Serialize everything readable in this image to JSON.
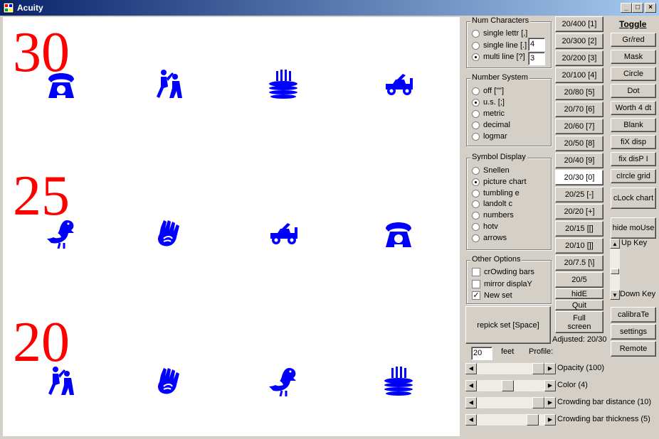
{
  "window": {
    "title": "Acuity",
    "minimize": "_",
    "maximize": "□",
    "close": "×"
  },
  "chart": {
    "rows": [
      {
        "label": "30",
        "symbols": [
          "telephone",
          "dancers",
          "cake",
          "jeep"
        ]
      },
      {
        "label": "25",
        "symbols": [
          "bird",
          "hand",
          "jeep",
          "telephone"
        ]
      },
      {
        "label": "20",
        "symbols": [
          "dancers",
          "hand",
          "bird",
          "cake"
        ]
      }
    ],
    "symbol_color": "#0000ff",
    "label_color": "#ff0000"
  },
  "num_characters": {
    "title": "Num Characters",
    "options": [
      "single lettr [,]",
      "single line [.]",
      "multi line [?]"
    ],
    "selected": 2,
    "single_line_value": "4",
    "multi_line_value": "3"
  },
  "number_system": {
    "title": "Number System",
    "options": [
      "off [\"\"]",
      "u.s. [;]",
      "metric",
      "decimal",
      "logmar"
    ],
    "selected": 1
  },
  "symbol_display": {
    "title": "Symbol Display",
    "options": [
      "Snellen",
      "picture chart",
      "tumbling e",
      "landolt c",
      "numbers",
      "hotv",
      "arrows"
    ],
    "selected": 1
  },
  "other_options": {
    "title": "Other Options",
    "options": [
      {
        "label": "crOwding bars",
        "checked": false
      },
      {
        "label": "mirror displaY",
        "checked": false
      },
      {
        "label": "New set",
        "checked": true
      }
    ]
  },
  "repick_button": "repick set [Space]",
  "acuity_buttons": [
    "20/400 [1]",
    "20/300 [2]",
    "20/200 [3]",
    "20/100 [4]",
    "20/80 [5]",
    "20/70 [6]",
    "20/60 [7]",
    "20/50 [8]",
    "20/40 [9]",
    "20/30 [0]",
    "20/25 [-]",
    "20/20 [+]",
    "20/15 [[]",
    "20/10 []]",
    "20/7.5 [\\]",
    "20/5"
  ],
  "acuity_selected": 9,
  "hide_button": "hidE",
  "quit_button": "Quit",
  "fullscreen_button": "Full screen",
  "adjusted_text": "Adjusted: 20/30",
  "toggle": {
    "title": "Toggle",
    "buttons": [
      "Gr/red",
      "Mask",
      "Circle",
      "Dot",
      "Worth 4 dt",
      "Blank",
      "fiX disp",
      "fix disP I",
      "cIrcle grid",
      "cLock chart",
      "hide moUse"
    ]
  },
  "keys": {
    "up": "Up Key",
    "down": "Down Key"
  },
  "bottom_buttons": [
    "calibraTe",
    "settings",
    "Remote"
  ],
  "distance": {
    "value": "20",
    "unit": "feet",
    "profile_label": "Profile:"
  },
  "sliders": [
    {
      "label": "Opacity (100)",
      "fraction": 1.0
    },
    {
      "label": "Color (4)",
      "fraction": 0.45
    },
    {
      "label": "Crowding bar distance (10)",
      "fraction": 1.0
    },
    {
      "label": "Crowding bar thickness (5)",
      "fraction": 0.9
    }
  ]
}
